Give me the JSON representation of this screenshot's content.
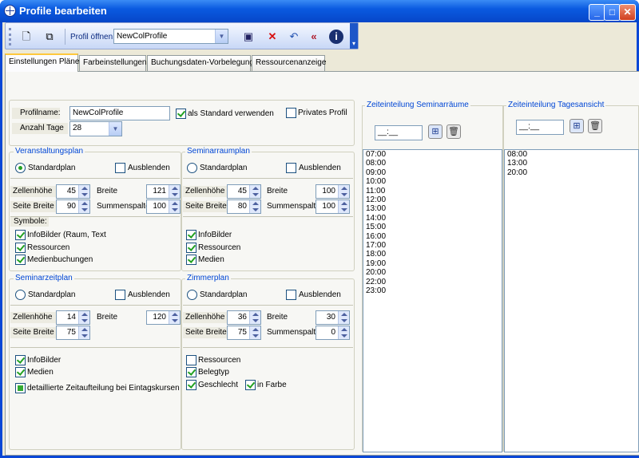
{
  "window": {
    "title": "Profile bearbeiten"
  },
  "toolbar": {
    "open_label": "Profil öffnen",
    "profile_value": "NewColProfile"
  },
  "tabs": [
    "Einstellungen Pläne",
    "Farbeinstellungen",
    "Buchungsdaten-Vorbelegung",
    "Ressourcenanzeige"
  ],
  "profile": {
    "name_label": "Profilname:",
    "name_value": "NewColProfile",
    "standard_label": "als Standard verwenden",
    "private_label": "Privates Profil",
    "days_label": "Anzahl Tage",
    "days_value": "28"
  },
  "veranstaltung": {
    "title": "Veranstaltungsplan",
    "standard": "Standardplan",
    "hide": "Ausblenden",
    "zh_label": "Zellenhöhe",
    "zh": "45",
    "breite_label": "Breite",
    "breite": "121",
    "sb_label": "Seite Breite",
    "sb": "90",
    "ss_label": "Summenspalte",
    "ss": "100",
    "symbols": "Symbole:",
    "c1": "InfoBilder (Raum, Text",
    "c2": "Ressourcen",
    "c3": "Medienbuchungen"
  },
  "seminarraum": {
    "title": "Seminarraumplan",
    "standard": "Standardplan",
    "hide": "Ausblenden",
    "zh_label": "Zellenhöhe",
    "zh": "45",
    "breite_label": "Breite",
    "breite": "100",
    "sb_label": "Seite Breite",
    "sb": "80",
    "ss_label": "Summenspalte",
    "ss": "100",
    "c1": "InfoBilder",
    "c2": "Ressourcen",
    "c3": "Medien"
  },
  "seminarzeit": {
    "title": "Seminarzeitplan",
    "standard": "Standardplan",
    "hide": "Ausblenden",
    "zh_label": "Zellenhöhe",
    "zh": "14",
    "breite_label": "Breite",
    "breite": "120",
    "sb_label": "Seite Breite",
    "sb": "75",
    "c1": "InfoBilder",
    "c2": "Medien",
    "c3": "detaillierte Zeitaufteilung bei Eintagskursen"
  },
  "zimmer": {
    "title": "Zimmerplan",
    "standard": "Standardplan",
    "hide": "Ausblenden",
    "zh_label": "Zellenhöhe",
    "zh": "36",
    "breite_label": "Breite",
    "breite": "30",
    "sb_label": "Seite Breite",
    "sb": "75",
    "ss_label": "Summenspalte",
    "ss": "0",
    "c1": "Ressourcen",
    "c2": "Belegtyp",
    "c3": "Geschlecht",
    "c4": "in Farbe"
  },
  "zeit_seminar": {
    "title": "Zeiteinteilung Seminarräume",
    "time_placeholder": "__:__",
    "times": [
      "07:00",
      "08:00",
      "09:00",
      "10:00",
      "11:00",
      "12:00",
      "13:00",
      "14:00",
      "15:00",
      "16:00",
      "17:00",
      "18:00",
      "19:00",
      "20:00",
      "22:00",
      "23:00"
    ]
  },
  "zeit_tag": {
    "title": "Zeiteinteilung Tagesansicht",
    "time_placeholder": "__:__",
    "times": [
      "08:00",
      "13:00",
      "20:00"
    ]
  }
}
